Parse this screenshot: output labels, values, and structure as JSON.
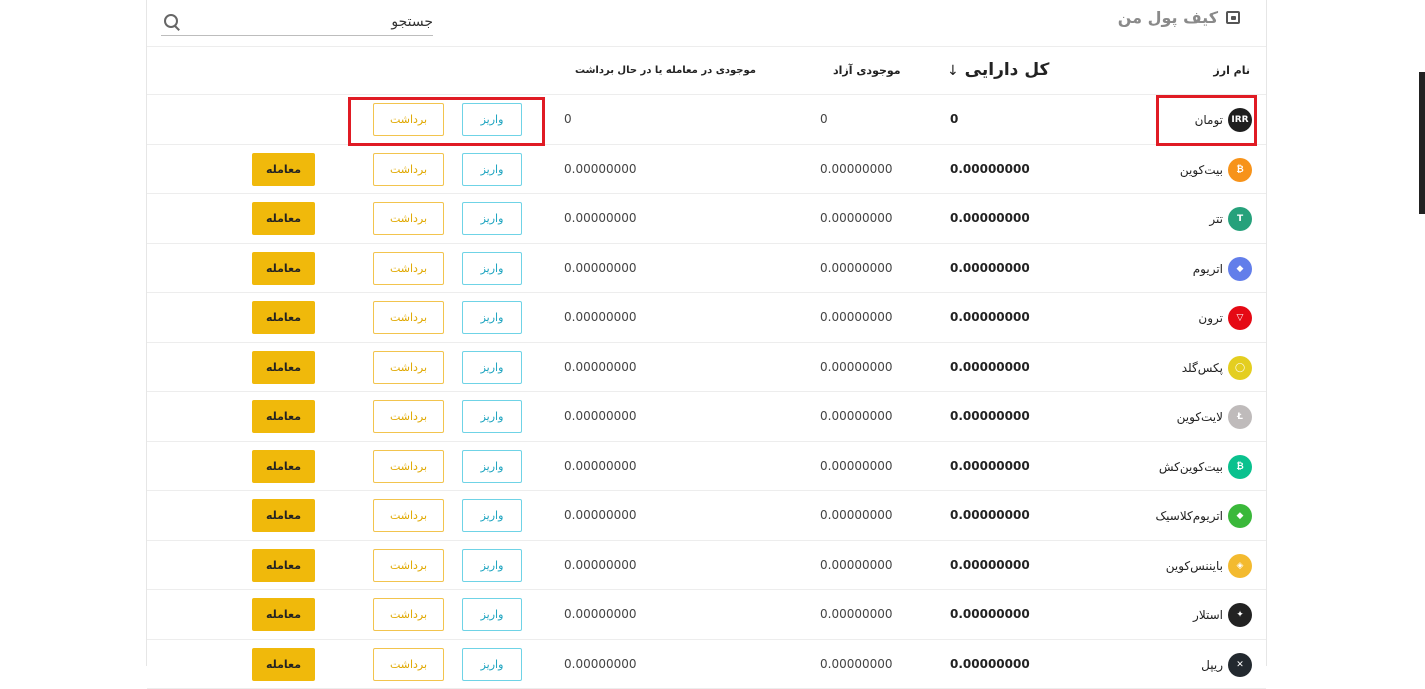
{
  "header": {
    "title": "کیف پول من",
    "search_placeholder": "جستجو"
  },
  "columns": {
    "name": "نام ارز",
    "total": "کل دارایی",
    "total_sort": "↓",
    "free": "موجودی آزاد",
    "locked": "موجودی در معامله یا در حال برداشت"
  },
  "buttons": {
    "deposit": "واریز",
    "withdraw": "برداشت",
    "trade": "معامله"
  },
  "rows": [
    {
      "name": "تومان",
      "icon": "irr-icon",
      "icon_text": "IRR",
      "color": "#1e1e1e",
      "total": "0",
      "free": "0",
      "locked": "0",
      "tradable": false
    },
    {
      "name": "بیت‌کوین",
      "icon": "bitcoin-icon",
      "icon_text": "₿",
      "color": "#f7931a",
      "total": "0.00000000",
      "free": "0.00000000",
      "locked": "0.00000000",
      "tradable": true
    },
    {
      "name": "تتر",
      "icon": "tether-icon",
      "icon_text": "T",
      "color": "#26a17b",
      "total": "0.00000000",
      "free": "0.00000000",
      "locked": "0.00000000",
      "tradable": true
    },
    {
      "name": "اتریوم",
      "icon": "ethereum-icon",
      "icon_text": "◆",
      "color": "#627eea",
      "total": "0.00000000",
      "free": "0.00000000",
      "locked": "0.00000000",
      "tradable": true
    },
    {
      "name": "ترون",
      "icon": "tron-icon",
      "icon_text": "▽",
      "color": "#e50914",
      "total": "0.00000000",
      "free": "0.00000000",
      "locked": "0.00000000",
      "tradable": true
    },
    {
      "name": "پکس‌گلد",
      "icon": "paxgold-icon",
      "icon_text": "◯",
      "color": "#e4ce20",
      "total": "0.00000000",
      "free": "0.00000000",
      "locked": "0.00000000",
      "tradable": true
    },
    {
      "name": "لایت‌کوین",
      "icon": "litecoin-icon",
      "icon_text": "Ł",
      "color": "#bfbbbb",
      "total": "0.00000000",
      "free": "0.00000000",
      "locked": "0.00000000",
      "tradable": true
    },
    {
      "name": "بیت‌کوین‌کش",
      "icon": "bitcoin-cash-icon",
      "icon_text": "₿",
      "color": "#0ac18e",
      "total": "0.00000000",
      "free": "0.00000000",
      "locked": "0.00000000",
      "tradable": true
    },
    {
      "name": "اتریوم‌کلاسیک",
      "icon": "ethereum-classic-icon",
      "icon_text": "◆",
      "color": "#3ab83a",
      "total": "0.00000000",
      "free": "0.00000000",
      "locked": "0.00000000",
      "tradable": true
    },
    {
      "name": "بایننس‌کوین",
      "icon": "bnb-icon",
      "icon_text": "◈",
      "color": "#f3ba2f",
      "total": "0.00000000",
      "free": "0.00000000",
      "locked": "0.00000000",
      "tradable": true
    },
    {
      "name": "استلار",
      "icon": "stellar-icon",
      "icon_text": "✦",
      "color": "#222222",
      "total": "0.00000000",
      "free": "0.00000000",
      "locked": "0.00000000",
      "tradable": true
    },
    {
      "name": "ریپل",
      "icon": "ripple-icon",
      "icon_text": "✕",
      "color": "#23292f",
      "total": "0.00000000",
      "free": "0.00000000",
      "locked": "0.00000000",
      "tradable": true
    }
  ],
  "colors": {
    "deposit_border": "#6fd3e6",
    "withdraw_border": "#f2c44e",
    "trade_bg": "#f0b90b",
    "highlight": "#e01b24"
  }
}
